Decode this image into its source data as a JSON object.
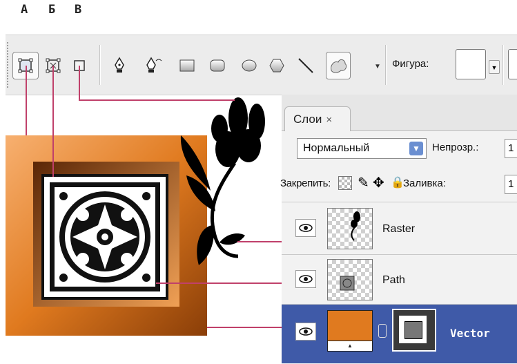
{
  "callouts": {
    "a": "А",
    "b": "Б",
    "c": "В"
  },
  "toolbar": {
    "shape_label": "Фигура:",
    "tools": [
      "shape-layers",
      "paths",
      "fill-pixels",
      "pen",
      "freeform-pen",
      "rectangle",
      "rounded-rectangle",
      "ellipse",
      "polygon",
      "line",
      "custom-shape"
    ]
  },
  "layers_panel": {
    "tab_label": "Слои",
    "tab_close": "×",
    "blend_mode": "Нормальный",
    "opacity_label": "Непрозр.:",
    "opacity_value": "1",
    "lock_label": "Закрепить:",
    "fill_label": "Заливка:",
    "fill_value": "1",
    "layers": [
      {
        "name": "Raster"
      },
      {
        "name": "Path"
      },
      {
        "name": "Vector",
        "selected": true
      }
    ]
  },
  "colors": {
    "accent": "#3f5aa8",
    "callout_line": "#c0406a",
    "orange": "#e07a1f"
  }
}
